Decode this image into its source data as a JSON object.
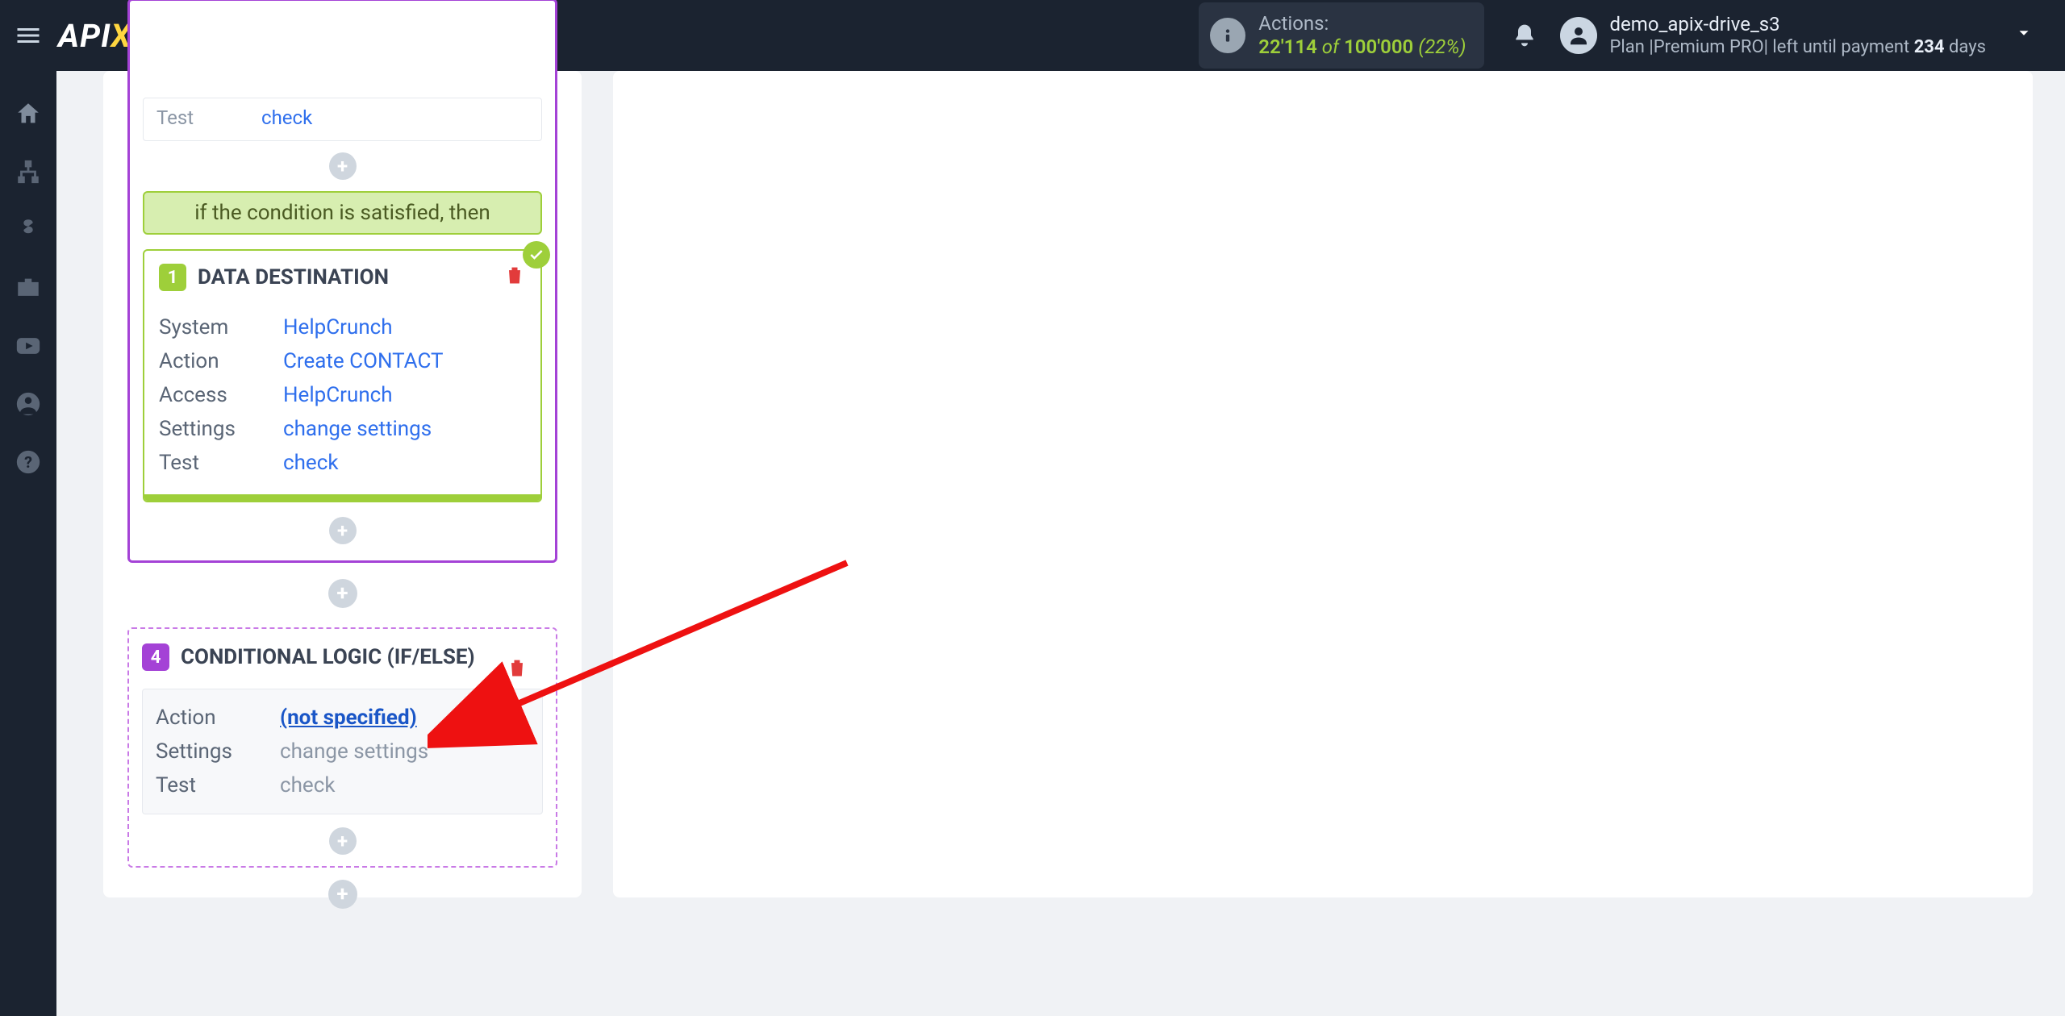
{
  "header": {
    "actions_label": "Actions:",
    "actions_used": "22'114",
    "actions_of": "of",
    "actions_total": "100'000",
    "actions_pct": "(22%)",
    "user_name": "demo_apix-drive_s3",
    "plan_prefix": "Plan |Premium PRO| left until payment ",
    "plan_days": "234",
    "plan_suffix": " days"
  },
  "flow": {
    "test_label": "Test",
    "check_link": "check",
    "condition_banner": "if the condition is satisfied, then",
    "dest": {
      "num": "1",
      "title": "DATA DESTINATION",
      "rows": {
        "system_k": "System",
        "system_v": "HelpCrunch",
        "action_k": "Action",
        "action_v": "Create CONTACT",
        "access_k": "Access",
        "access_v": "HelpCrunch",
        "settings_k": "Settings",
        "settings_v": "change settings",
        "test_k": "Test",
        "test_v": "check"
      }
    },
    "logic": {
      "num": "4",
      "title": "CONDITIONAL LOGIC (IF/ELSE)",
      "rows": {
        "action_k": "Action",
        "action_v": "(not specified)",
        "settings_k": "Settings",
        "settings_v": "change settings",
        "test_k": "Test",
        "test_v": "check"
      }
    }
  }
}
